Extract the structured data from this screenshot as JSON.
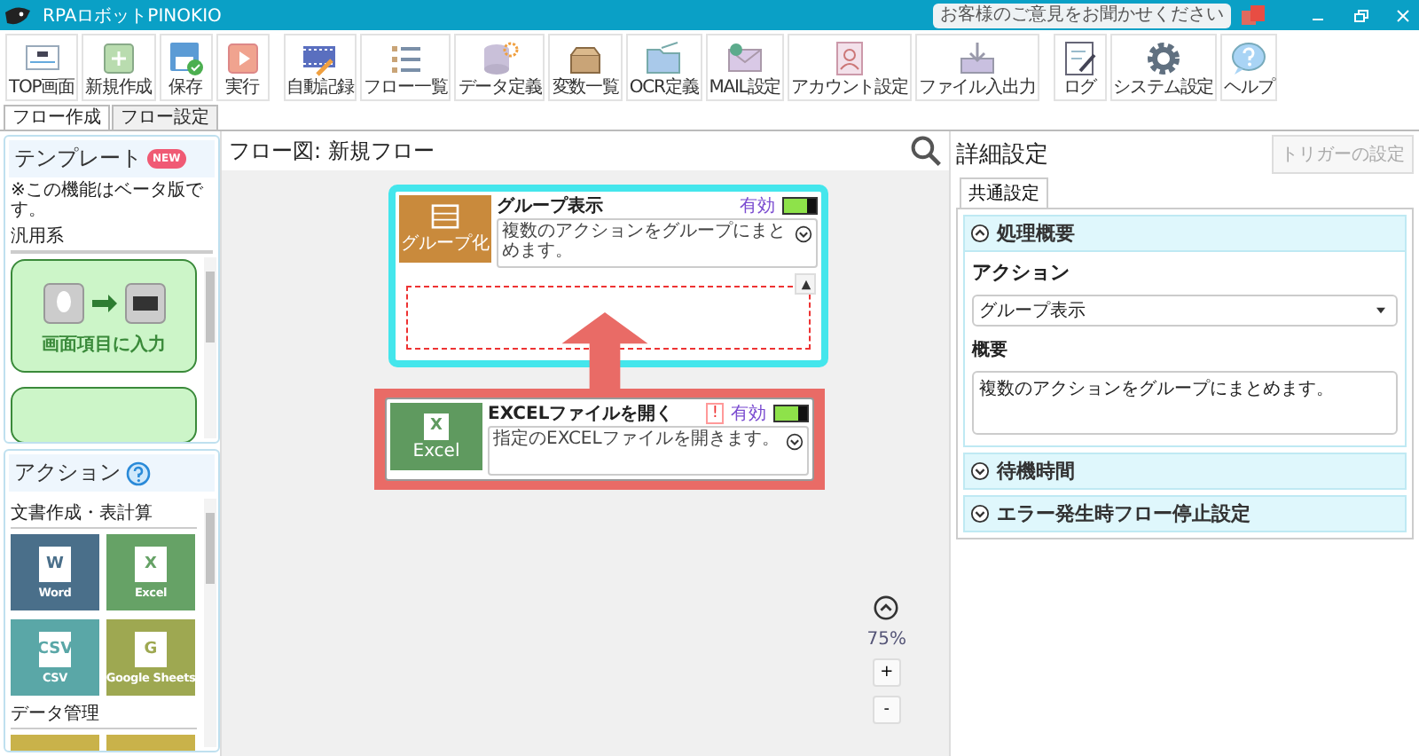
{
  "window": {
    "title": "RPAロボットPINOKIO",
    "feedback": "お客様のご意見をお聞かせください"
  },
  "toolbar": [
    [
      {
        "label": "TOP画面"
      },
      {
        "label": "新規作成"
      },
      {
        "label": "保存"
      },
      {
        "label": "実行"
      }
    ],
    [
      {
        "label": "自動記録"
      },
      {
        "label": "フロー一覧"
      },
      {
        "label": "データ定義"
      },
      {
        "label": "変数一覧"
      },
      {
        "label": "OCR定義"
      },
      {
        "label": "MAIL設定"
      },
      {
        "label": "アカウント設定"
      },
      {
        "label": "ファイル入出力"
      }
    ],
    [
      {
        "label": "ログ"
      },
      {
        "label": "システム設定"
      },
      {
        "label": "ヘルプ"
      }
    ]
  ],
  "tabs": [
    {
      "label": "フロー作成",
      "selected": true
    },
    {
      "label": "フロー設定",
      "selected": false
    }
  ],
  "templates": {
    "title": "テンプレート",
    "badge": "NEW",
    "note": "※この機能はベータ版です。",
    "category": "汎用系",
    "items": [
      {
        "label": "画面項目に入力"
      }
    ]
  },
  "actions": {
    "title": "アクション",
    "groups": [
      {
        "name": "文書作成・表計算",
        "items": [
          {
            "label": "Word",
            "letter": "W",
            "color": "#4a6f8a"
          },
          {
            "label": "Excel",
            "letter": "X",
            "color": "#66a266"
          },
          {
            "label": "CSV",
            "letter": "CSV",
            "color": "#5aa7a7"
          },
          {
            "label": "Google Sheets",
            "letter": "G",
            "color": "#9ea851"
          }
        ]
      },
      {
        "name": "データ管理",
        "items": [
          {
            "color": "#c9b24a"
          },
          {
            "color": "#c9b24a"
          }
        ]
      }
    ]
  },
  "flow": {
    "title": "フロー図: 新規フロー",
    "nodes": [
      {
        "kind": "group",
        "title": "グループ表示",
        "icon_label": "グループ化",
        "status": "有効",
        "enabled": true,
        "warning": false,
        "description": "複数のアクションをグループにまとめます。",
        "selected": true,
        "highlighted": false
      },
      {
        "kind": "action",
        "title": "EXCELファイルを開く",
        "icon_label": "Excel",
        "icon_letter": "X",
        "status": "有効",
        "enabled": true,
        "warning": true,
        "warning_mark": "!",
        "description": "指定のEXCELファイルを開きます。",
        "selected": false,
        "highlighted": true
      }
    ],
    "zoom": "75%",
    "zoom_in": "+",
    "zoom_out": "-"
  },
  "details": {
    "title": "詳細設定",
    "trigger_button": "トリガーの設定",
    "tab": "共通設定",
    "sections": [
      {
        "title": "処理概要",
        "expanded": true,
        "fields": [
          {
            "kind": "select",
            "label": "アクション",
            "value": "グループ表示"
          },
          {
            "kind": "textarea",
            "label": "概要",
            "value": "複数のアクションをグループにまとめます。"
          }
        ]
      },
      {
        "title": "待機時間",
        "expanded": false
      },
      {
        "title": "エラー発生時フロー停止設定",
        "expanded": false
      }
    ]
  }
}
